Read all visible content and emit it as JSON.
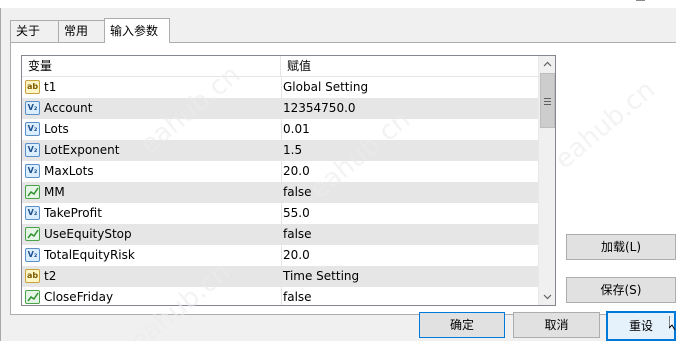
{
  "tabs": [
    {
      "label": "关于"
    },
    {
      "label": "常用"
    },
    {
      "label": "输入参数"
    }
  ],
  "grid": {
    "headers": {
      "variable": "变量",
      "value": "赋值"
    },
    "rows": [
      {
        "icon": "ab",
        "icon_name": "string-type-icon",
        "name": "t1",
        "value": "Global Setting"
      },
      {
        "icon": "var",
        "icon_name": "numeric-type-icon",
        "name": "Account",
        "value": "12354750.0"
      },
      {
        "icon": "var",
        "icon_name": "numeric-type-icon",
        "name": "Lots",
        "value": "0.01"
      },
      {
        "icon": "var",
        "icon_name": "numeric-type-icon",
        "name": "LotExponent",
        "value": "1.5"
      },
      {
        "icon": "var",
        "icon_name": "numeric-type-icon",
        "name": "MaxLots",
        "value": "20.0"
      },
      {
        "icon": "bool",
        "icon_name": "boolean-type-icon",
        "name": "MM",
        "value": "false"
      },
      {
        "icon": "var",
        "icon_name": "numeric-type-icon",
        "name": "TakeProfit",
        "value": "55.0"
      },
      {
        "icon": "bool",
        "icon_name": "boolean-type-icon",
        "name": "UseEquityStop",
        "value": "false"
      },
      {
        "icon": "var",
        "icon_name": "numeric-type-icon",
        "name": "TotalEquityRisk",
        "value": "20.0"
      },
      {
        "icon": "ab",
        "icon_name": "string-type-icon",
        "name": "t2",
        "value": "Time Setting"
      },
      {
        "icon": "bool",
        "icon_name": "boolean-type-icon",
        "name": "CloseFriday",
        "value": "false"
      }
    ]
  },
  "buttons": {
    "load": "加载(L)",
    "save": "保存(S)",
    "ok": "确定",
    "cancel": "取消",
    "reset": "重设"
  },
  "icon_codes": {
    "ab": "ab",
    "var": "V₂"
  },
  "watermark": "eahub.cn",
  "colors": {
    "accent": "#0078d7",
    "alt_row": "#e6e6e6",
    "dialog_bg": "#f0f0f0"
  }
}
